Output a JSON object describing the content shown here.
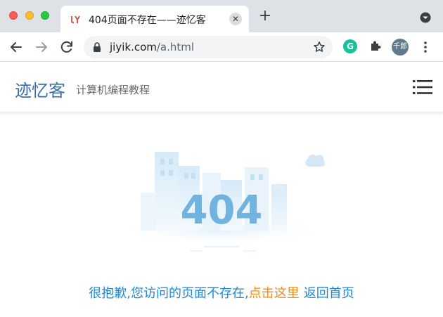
{
  "browser": {
    "tab_title": "404页面不存在——迹忆客",
    "tab_close": "✕",
    "new_tab": "+",
    "url_host": "jiyik.com",
    "url_path": "/a.html",
    "profile_label": "千郎",
    "extension_letter": "G"
  },
  "site": {
    "title": "迹忆客",
    "subtitle": "计算机编程教程"
  },
  "error": {
    "code": "404",
    "message": "很抱歉,您访问的页面不存在,",
    "link_text": "点击这里",
    "home_text": "返回首页"
  },
  "colors": {
    "brand": "#3a6ea5",
    "message": "#1e88d8",
    "link": "#f08c1c",
    "code": "#6fb3de"
  }
}
